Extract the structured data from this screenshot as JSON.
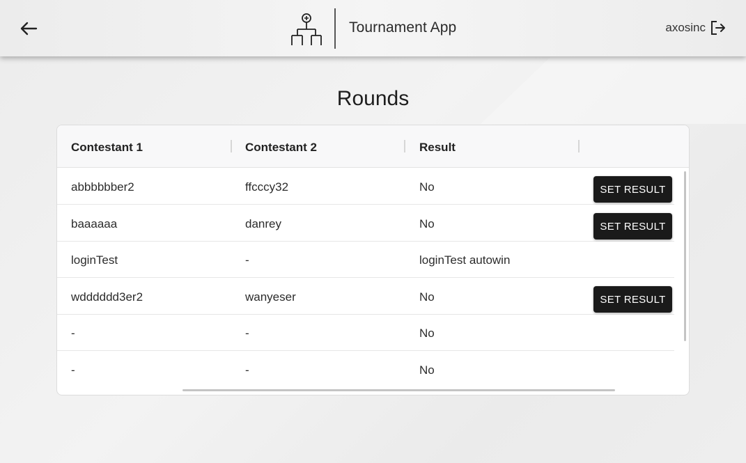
{
  "header": {
    "app_title": "Tournament App",
    "username": "axosinc",
    "back_icon": "arrow-left-icon",
    "logout_icon": "logout-icon",
    "logo_icon": "bracket-tree-icon"
  },
  "page": {
    "title": "Rounds"
  },
  "table": {
    "columns": [
      "Contestant 1",
      "Contestant 2",
      "Result",
      ""
    ],
    "rows": [
      {
        "contestant1": "abbbbbber2",
        "contestant2": "ffcccy32",
        "result": "No",
        "action": "SET RESULT"
      },
      {
        "contestant1": "baaaaaa",
        "contestant2": "danrey",
        "result": "No",
        "action": "SET RESULT"
      },
      {
        "contestant1": "loginTest",
        "contestant2": "-",
        "result": "loginTest autowin",
        "action": ""
      },
      {
        "contestant1": "wdddddd3er2",
        "contestant2": "wanyeser",
        "result": "No",
        "action": "SET RESULT"
      },
      {
        "contestant1": "-",
        "contestant2": "-",
        "result": "No",
        "action": ""
      },
      {
        "contestant1": "-",
        "contestant2": "-",
        "result": "No",
        "action": ""
      }
    ]
  },
  "colors": {
    "button_bg": "#1a1a1a",
    "button_text": "#ffffff",
    "header_bg": "#f0f0f0"
  }
}
